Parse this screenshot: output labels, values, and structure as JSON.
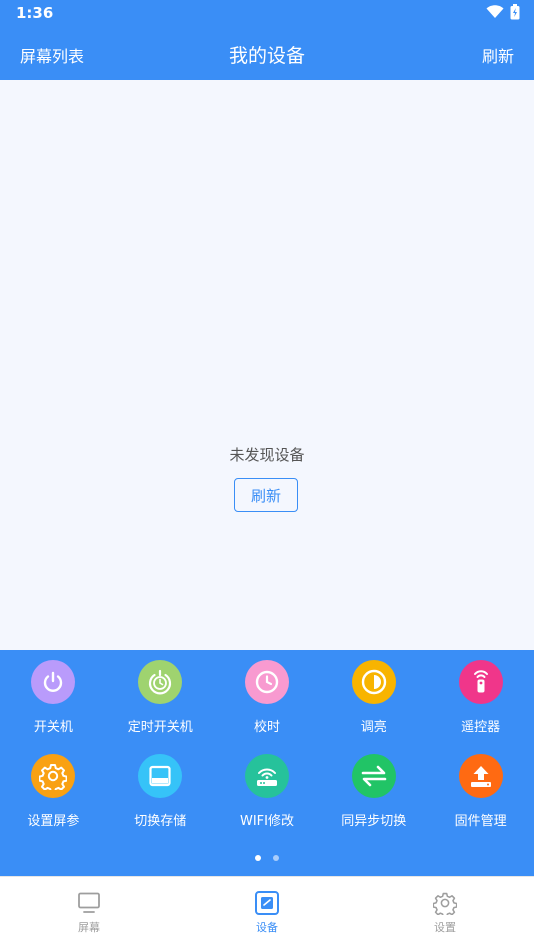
{
  "status_bar": {
    "time": "1:36"
  },
  "header": {
    "left_label": "屏幕列表",
    "title": "我的设备",
    "right_label": "刷新"
  },
  "main": {
    "empty_text": "未发现设备",
    "refresh_label": "刷新"
  },
  "functions": [
    {
      "label": "开关机",
      "icon": "power-icon",
      "color": "#b99bfb"
    },
    {
      "label": "定时开关机",
      "icon": "timer-power-icon",
      "color": "#9fd36f"
    },
    {
      "label": "校时",
      "icon": "clock-icon",
      "color": "#f89ad0"
    },
    {
      "label": "调亮",
      "icon": "brightness-icon",
      "color": "#f8b400"
    },
    {
      "label": "遥控器",
      "icon": "remote-icon",
      "color": "#f0368a"
    },
    {
      "label": "设置屏参",
      "icon": "gear-icon",
      "color": "#f9a113"
    },
    {
      "label": "切换存储",
      "icon": "storage-icon",
      "color": "#36c3f8"
    },
    {
      "label": "WIFI修改",
      "icon": "wifi-router-icon",
      "color": "#26c29b"
    },
    {
      "label": "同异步切换",
      "icon": "sync-switch-icon",
      "color": "#21c466"
    },
    {
      "label": "固件管理",
      "icon": "upload-icon",
      "color": "#ff6a12"
    }
  ],
  "pager": {
    "active_color": "#ffffff",
    "inactive_color": "#a9cdfb"
  },
  "bottom_nav": [
    {
      "label": "屏幕",
      "icon": "monitor-icon"
    },
    {
      "label": "设备",
      "icon": "device-icon",
      "active": true
    },
    {
      "label": "设置",
      "icon": "settings-icon"
    }
  ],
  "colors": {
    "primary": "#3a8ef6",
    "nav_inactive": "#9e9e9e",
    "content_bg": "#f4f7fe"
  }
}
